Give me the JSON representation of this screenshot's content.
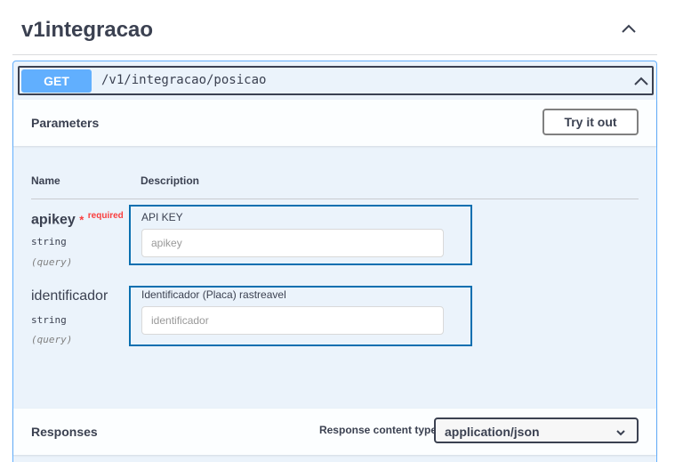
{
  "tag": {
    "title": "v1integracao",
    "toggle_icon": "chevron-up-icon"
  },
  "operation": {
    "method": "GET",
    "path": "/v1/integracao/posicao",
    "method_color": "#61affe",
    "accent_color": "#ebf3fb"
  },
  "parameters": {
    "title": "Parameters",
    "try_button": "Try it out",
    "col_name": "Name",
    "col_description": "Description",
    "items": [
      {
        "name": "apikey",
        "required_star": "*",
        "required_label": "required",
        "type": "string",
        "in": "(query)",
        "description": "API KEY",
        "placeholder": "apikey",
        "value": ""
      },
      {
        "name": "identificador",
        "type": "string",
        "in": "(query)",
        "description": "Identificador (Placa) rastreavel",
        "placeholder": "identificador",
        "value": ""
      }
    ]
  },
  "responses": {
    "title": "Responses",
    "content_type_label": "Response content type",
    "content_type_value": "application/json"
  }
}
